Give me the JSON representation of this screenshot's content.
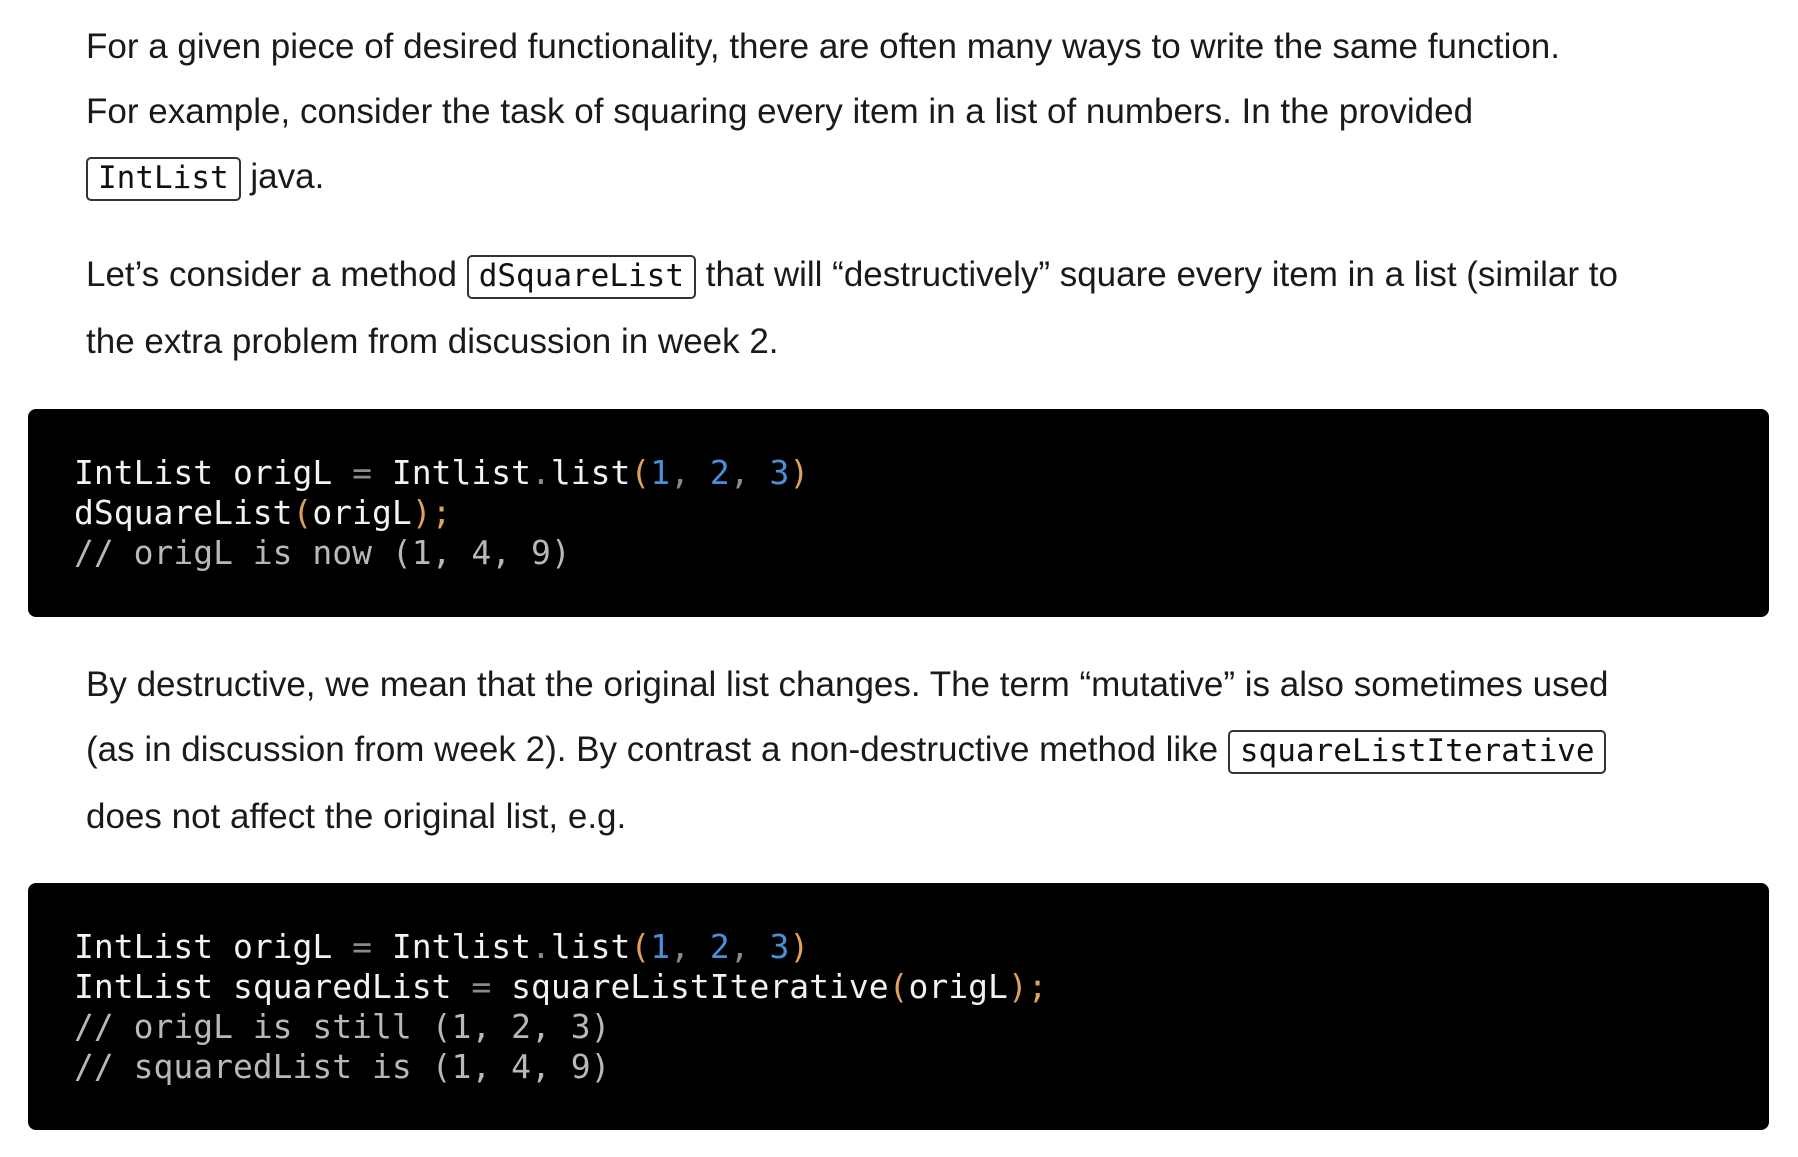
{
  "paragraph1": {
    "text_a": "For a given piece of desired functionality, there are often many ways to write the same function.",
    "text_b": "For example, consider the task of squaring every item in a list of numbers. In the provided",
    "code": "IntList",
    "text_c": " java."
  },
  "paragraph2": {
    "text_a": "Let’s consider a method ",
    "code": "dSquareList",
    "text_b": " that will “destructively” square every item in a list (similar to",
    "text_c": "the extra problem from discussion in week 2."
  },
  "code_block1": {
    "line1": {
      "type": "IntList",
      "var": " origL ",
      "eq": "=",
      "cls": " Intlist",
      "dot": ".",
      "method": "list",
      "open": "(",
      "n1": "1",
      "c1": ", ",
      "n2": "2",
      "c2": ", ",
      "n3": "3",
      "close": ")"
    },
    "line2": {
      "call": "dSquareList",
      "open": "(",
      "arg": "origL",
      "close": ");"
    },
    "line3": {
      "comment": "// origL is now (1, 4, 9)"
    }
  },
  "paragraph3": {
    "text_a": "By destructive, we mean that the original list changes. The term “mutative” is also sometimes used",
    "text_b": "(as in discussion from week 2). By contrast a non-destructive method like ",
    "code": "squareListIterative",
    "text_c": "does not affect the original list, e.g."
  },
  "code_block2": {
    "line1": {
      "type": "IntList",
      "var": " origL ",
      "eq": "=",
      "cls": " Intlist",
      "dot": ".",
      "method": "list",
      "open": "(",
      "n1": "1",
      "c1": ", ",
      "n2": "2",
      "c2": ", ",
      "n3": "3",
      "close": ")"
    },
    "line2": {
      "type": "IntList",
      "var": " squaredList ",
      "eq": "=",
      "call": " squareListIterative",
      "open": "(",
      "arg": "origL",
      "close": ");"
    },
    "line3": {
      "comment": "// origL is still (1, 2, 3)"
    },
    "line4": {
      "comment": "// squaredList is (1, 4, 9)"
    }
  }
}
